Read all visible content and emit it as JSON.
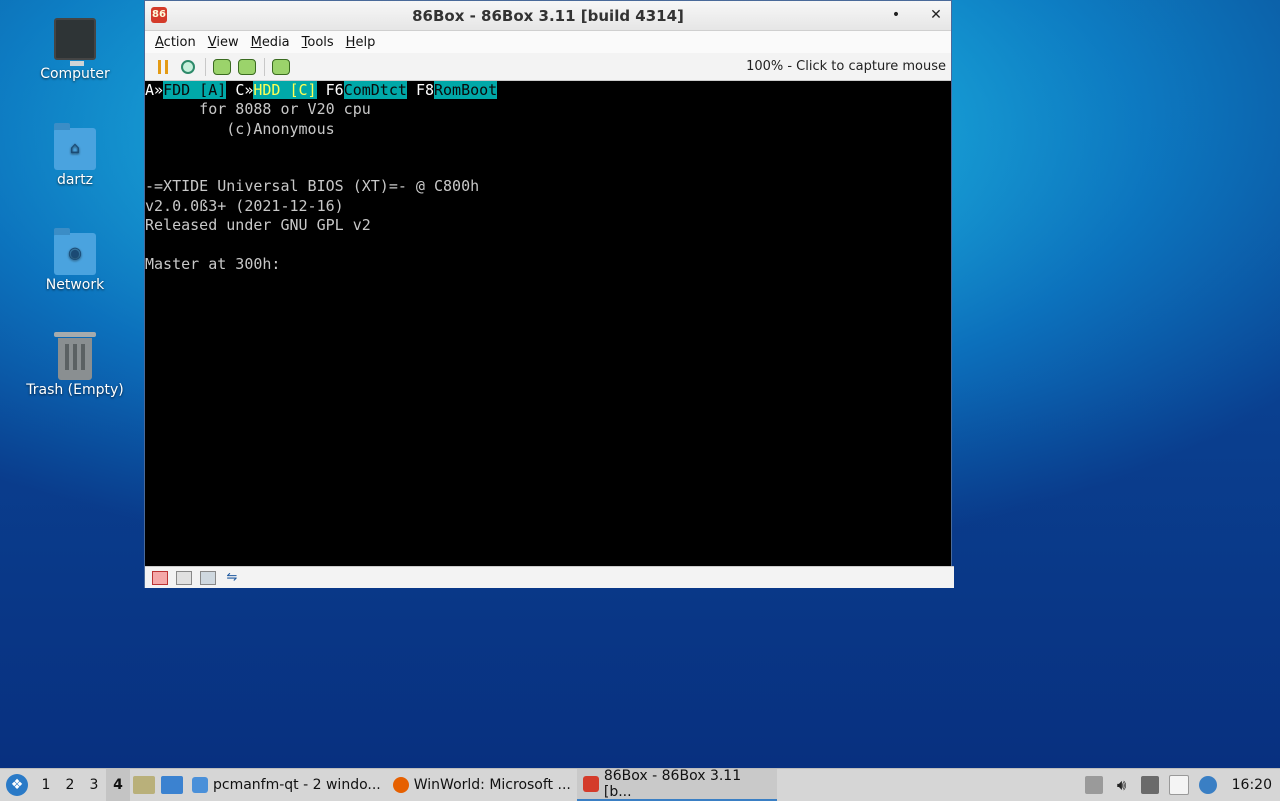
{
  "desktop": {
    "icons": [
      {
        "label": "Computer",
        "icon": "computer-icon"
      },
      {
        "label": "dartz",
        "icon": "home-folder-icon"
      },
      {
        "label": "Network",
        "icon": "network-folder-icon"
      },
      {
        "label": "Trash (Empty)",
        "icon": "trash-icon"
      }
    ]
  },
  "window": {
    "title": "86Box - 86Box 3.11 [build 4314]",
    "minimize_glyph": "•",
    "close_glyph": "✕",
    "menu": [
      "Action",
      "View",
      "Media",
      "Tools",
      "Help"
    ],
    "toolbar": {
      "buttons": [
        "pause-icon",
        "reset-icon",
        "ctrl-alt-del-icon",
        "ctrl-alt-esc-icon",
        "settings-icon"
      ],
      "capture_text": "100% - Click to capture mouse"
    },
    "screen": {
      "line1": {
        "a_prefix": "A»",
        "fdd": "FDD [A]",
        "c_prefix": "C»",
        "hdd": "HDD [C]",
        "f6": "F6",
        "comdtct": "ComDtct",
        "f8": "F8",
        "romboot": "RomBoot"
      },
      "line2": "      for 8088 or V20 cpu",
      "line3": "         (c)Anonymous",
      "line4": "-=XTIDE Universal BIOS (XT)=- @ C800h",
      "line5": "v2.0.0ß3+ (2021-12-16)",
      "line6": "Released under GNU GPL v2",
      "line7": "Master at 300h:"
    },
    "statusbar": [
      "floppy-drive-icon",
      "cdrom-icon",
      "hard-disk-icon",
      "network-status-icon"
    ]
  },
  "taskbar": {
    "workspaces": [
      "1",
      "2",
      "3",
      "4"
    ],
    "active_workspace": "4",
    "tasks": [
      {
        "label": "pcmanfm-qt - 2 windo...",
        "icon": "folder-icon",
        "color": "#4a90d9"
      },
      {
        "label": "WinWorld: Microsoft ...",
        "icon": "firefox-icon",
        "color": "#e66000"
      },
      {
        "label": "86Box - 86Box 3.11 [b...",
        "icon": "86box-icon",
        "color": "#d43b2a"
      }
    ],
    "clock": "16:20"
  }
}
